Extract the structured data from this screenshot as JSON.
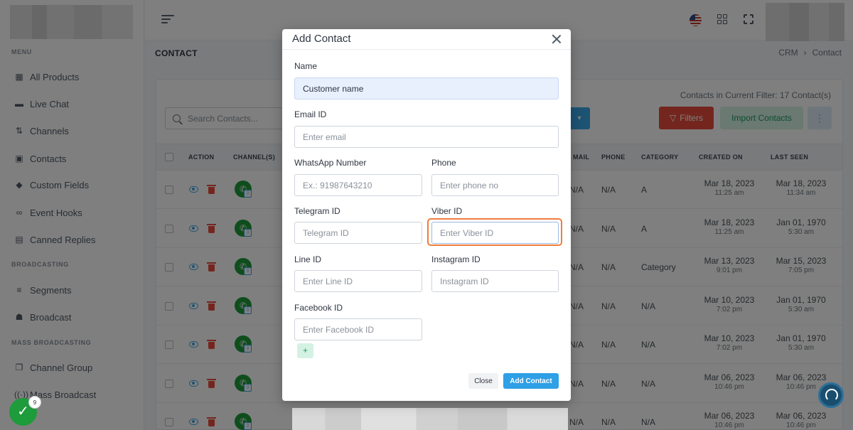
{
  "sidebar": {
    "sections": [
      {
        "title": "MENU",
        "items": [
          {
            "label": "All Products",
            "icon": "grid-icon"
          },
          {
            "label": "Live Chat",
            "icon": "chat-icon"
          },
          {
            "label": "Channels",
            "icon": "channels-icon"
          },
          {
            "label": "Contacts",
            "icon": "contacts-icon"
          },
          {
            "label": "Custom Fields",
            "icon": "tag-icon"
          },
          {
            "label": "Event Hooks",
            "icon": "link-icon"
          },
          {
            "label": "Canned Replies",
            "icon": "message-icon"
          }
        ]
      },
      {
        "title": "BROADCASTING",
        "items": [
          {
            "label": "Segments",
            "icon": "filter-lines-icon"
          },
          {
            "label": "Broadcast",
            "icon": "broadcast-icon"
          }
        ]
      },
      {
        "title": "MASS BROADCASTING",
        "items": [
          {
            "label": "Channel Group",
            "icon": "channel-group-icon"
          },
          {
            "label": "Mass Broadcast",
            "icon": "mass-broadcast-icon"
          }
        ]
      }
    ]
  },
  "page": {
    "title": "CONTACT",
    "breadcrumb": [
      "CRM",
      "Contact"
    ],
    "breadcrumb_sep": "›"
  },
  "contacts": {
    "filter_count": "Contacts in Current Filter: 17 Contact(s)",
    "search_placeholder": "Search Contacts...",
    "buttons": {
      "filters": "Filters",
      "import": "Import Contacts",
      "more": "⋮"
    },
    "columns": [
      "ACTION",
      "CHANNEL(S)",
      "MAIL",
      "PHONE",
      "CATEGORY",
      "CREATED ON",
      "LAST SEEN"
    ],
    "rows": [
      {
        "mail": "N/A",
        "phone": "N/A",
        "category": "A",
        "created_date": "Mar 18, 2023",
        "created_time": "11:25 am",
        "seen_date": "Mar 18, 2023",
        "seen_time": "11:34 am"
      },
      {
        "mail": "N/A",
        "phone": "N/A",
        "category": "A",
        "created_date": "Mar 18, 2023",
        "created_time": "11:25 am",
        "seen_date": "Jan 01, 1970",
        "seen_time": "5:30 am"
      },
      {
        "mail": "N/A",
        "phone": "N/A",
        "category": "Category",
        "created_date": "Mar 13, 2023",
        "created_time": "9:01 pm",
        "seen_date": "Mar 15, 2023",
        "seen_time": "7:05 pm"
      },
      {
        "mail": "N/A",
        "phone": "N/A",
        "category": "N/A",
        "created_date": "Mar 10, 2023",
        "created_time": "7:02 pm",
        "seen_date": "Jan 01, 1970",
        "seen_time": "5:30 am"
      },
      {
        "mail": "N/A",
        "phone": "N/A",
        "category": "N/A",
        "created_date": "Mar 10, 2023",
        "created_time": "7:02 pm",
        "seen_date": "Jan 01, 1970",
        "seen_time": "5:30 am"
      },
      {
        "mail": "N/A",
        "phone": "N/A",
        "category": "N/A",
        "created_date": "Mar 06, 2023",
        "created_time": "10:46 pm",
        "seen_date": "Mar 06, 2023",
        "seen_time": "10:46 pm"
      },
      {
        "mail": "N/A",
        "phone": "N/A",
        "category": "N/A",
        "created_date": "Mar 06, 2023",
        "created_time": "10:46 pm",
        "seen_date": "Mar 06, 2023",
        "seen_time": "10:46 pm"
      }
    ]
  },
  "modal": {
    "title": "Add Contact",
    "fields": {
      "name": {
        "label": "Name",
        "value": "Customer name"
      },
      "email": {
        "label": "Email ID",
        "placeholder": "Enter email"
      },
      "whatsapp": {
        "label": "WhatsApp Number",
        "placeholder": "Ex.: 91987643210"
      },
      "phone": {
        "label": "Phone",
        "placeholder": "Enter phone no"
      },
      "telegram": {
        "label": "Telegram ID",
        "placeholder": "Telegram ID"
      },
      "viber": {
        "label": "Viber ID",
        "placeholder": "Enter Viber ID"
      },
      "line": {
        "label": "Line ID",
        "placeholder": "Enter Line ID"
      },
      "instagram": {
        "label": "Instagram ID",
        "placeholder": "Instagram ID"
      },
      "facebook": {
        "label": "Facebook ID",
        "placeholder": "Enter Facebook ID"
      }
    },
    "plus_label": "+",
    "close_label": "Close",
    "submit_label": "Add Contact"
  },
  "widgets": {
    "badge_count": "9",
    "check": "✓"
  },
  "colors": {
    "accent": "#2f9fe6",
    "danger": "#e84c3d",
    "success": "#1e9b61",
    "focus": "#ef7d3c"
  }
}
